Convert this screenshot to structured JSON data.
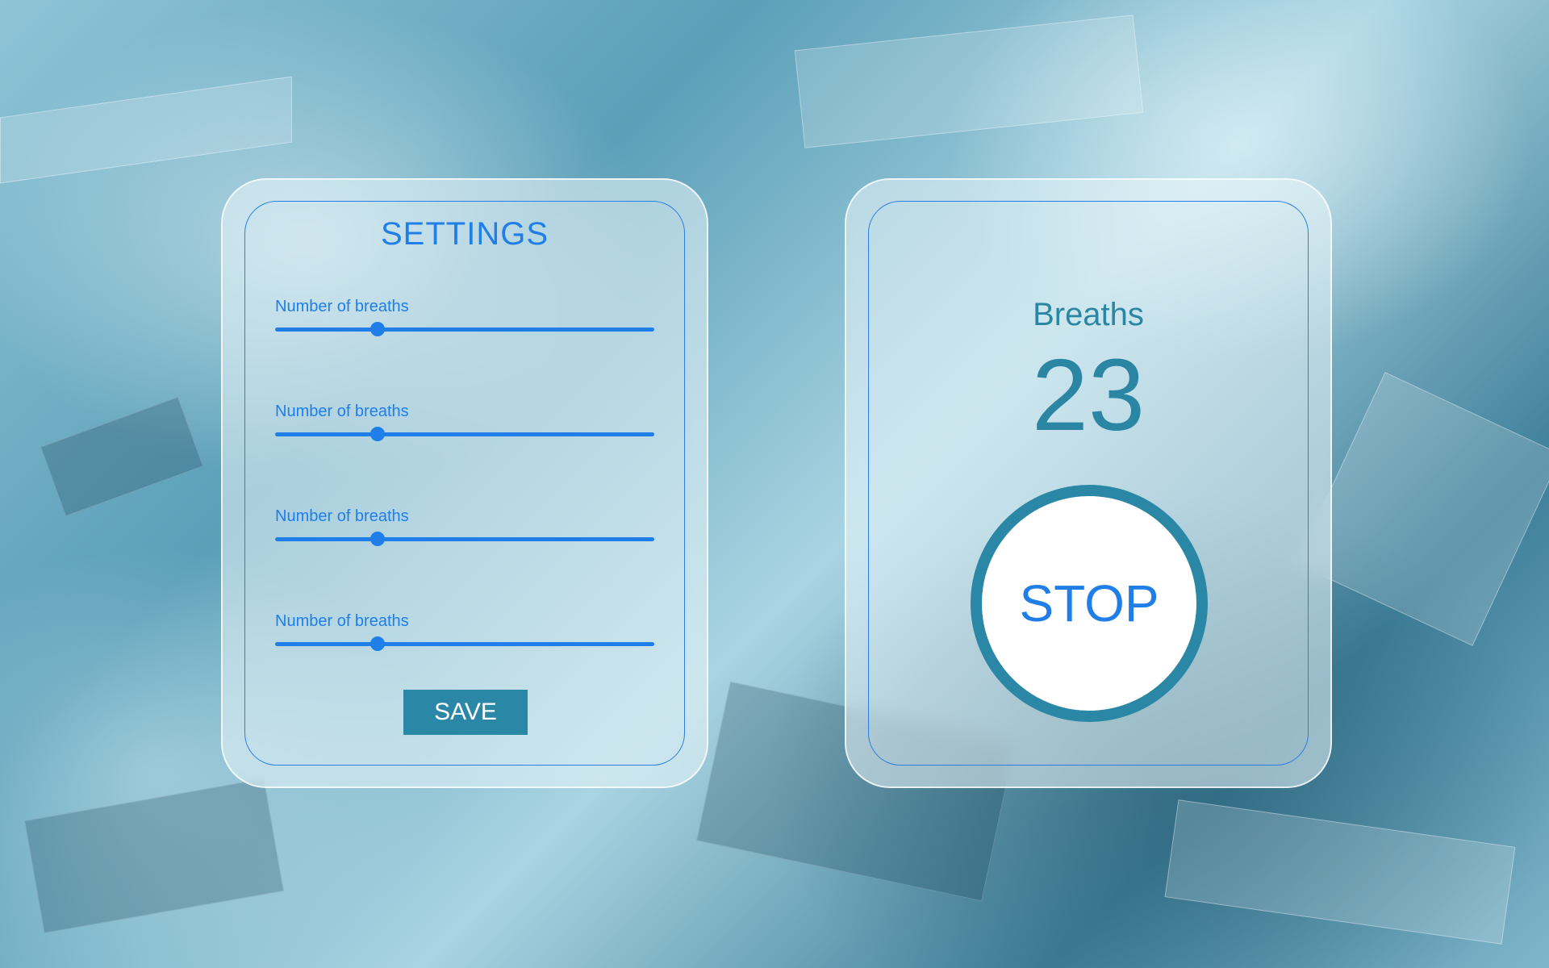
{
  "settings": {
    "title": "SETTINGS",
    "sliders": [
      {
        "label": "Number of breaths",
        "value_fraction": 0.27
      },
      {
        "label": "Number of breaths",
        "value_fraction": 0.27
      },
      {
        "label": "Number of breaths",
        "value_fraction": 0.27
      },
      {
        "label": "Number of breaths",
        "value_fraction": 0.27
      }
    ],
    "save_label": "SAVE"
  },
  "counter": {
    "label": "Breaths",
    "count": "23",
    "stop_label": "STOP"
  },
  "colors": {
    "accent_blue": "#1f7ee8",
    "teal": "#2b87a6",
    "card_background": "rgba(235,245,250,0.55)"
  }
}
